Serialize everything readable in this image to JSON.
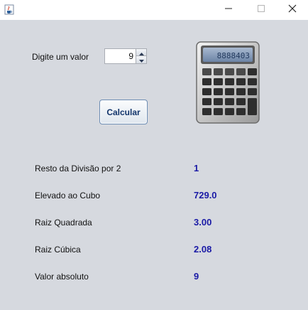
{
  "window": {
    "title": "",
    "icons": {
      "app": "java-cup-icon",
      "minimize": "minimize-icon",
      "maximize": "maximize-icon",
      "close": "close-icon"
    }
  },
  "input": {
    "label": "Digite um valor",
    "value": "9"
  },
  "actions": {
    "calculate_label": "Calcular"
  },
  "illustration": {
    "display": "8888403"
  },
  "results": [
    {
      "label": "Resto da Divisão por 2",
      "value": "1"
    },
    {
      "label": "Elevado ao Cubo",
      "value": "729.0"
    },
    {
      "label": "Raiz Quadrada",
      "value": "3.00"
    },
    {
      "label": "Raiz Cúbica",
      "value": "2.08"
    },
    {
      "label": "Valor absoluto",
      "value": "9"
    }
  ],
  "colors": {
    "background": "#d6d9df",
    "result_value": "#1a1aa6",
    "button_text": "#13356b"
  }
}
